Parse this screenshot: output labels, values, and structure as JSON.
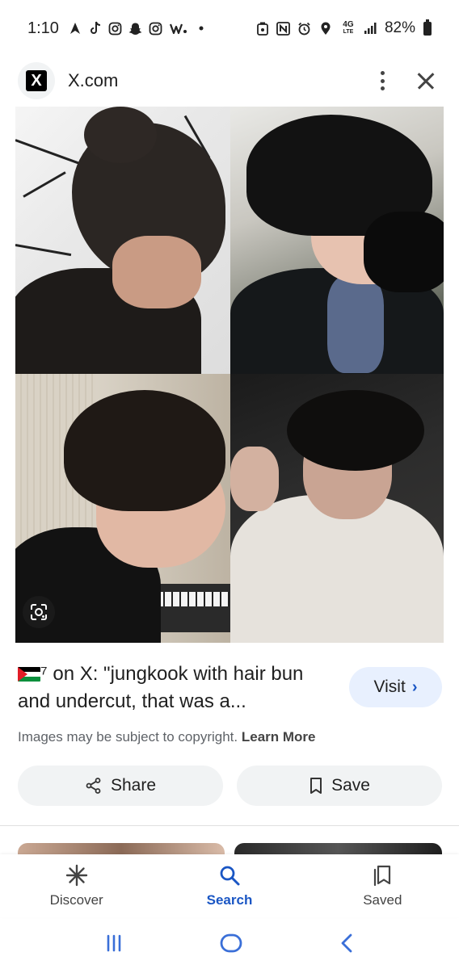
{
  "status_bar": {
    "time": "1:10",
    "battery": "82%",
    "left_icons": [
      "navigation-icon",
      "tiktok-icon",
      "instagram-icon",
      "snapchat-icon",
      "instagram-icon",
      "weverse-icon",
      "dot-icon"
    ],
    "right_icons": [
      "alarm-icon",
      "nfc-icon",
      "alarm-clock-icon",
      "location-icon",
      "4g-lte-icon",
      "signal-icon",
      "battery-icon"
    ]
  },
  "header": {
    "site_name": "X.com",
    "logo_letter": "X"
  },
  "result": {
    "title_prefix": "⁷ on X: \"jungkook with hair bun and undercut, that was a...",
    "visit_label": "Visit",
    "copyright_text": "Images may be subject to copyright.",
    "learn_more": "Learn More",
    "share_label": "Share",
    "save_label": "Save"
  },
  "bottom_nav": {
    "items": [
      {
        "label": "Discover",
        "icon": "asterisk-icon"
      },
      {
        "label": "Search",
        "icon": "search-icon",
        "active": true
      },
      {
        "label": "Saved",
        "icon": "bookmarks-icon"
      }
    ]
  },
  "colors": {
    "accent": "#1a56c4",
    "visit_bg": "#e8f0fe",
    "button_bg": "#f1f3f4"
  }
}
